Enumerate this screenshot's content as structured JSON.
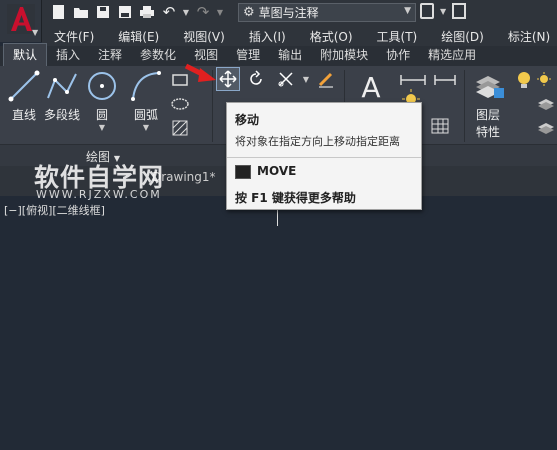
{
  "qat": {
    "workspace": "草图与注释"
  },
  "menu": [
    "文件(F)",
    "编辑(E)",
    "视图(V)",
    "插入(I)",
    "格式(O)",
    "工具(T)",
    "绘图(D)",
    "标注(N)"
  ],
  "ribbon_tabs": [
    "默认",
    "插入",
    "注释",
    "参数化",
    "视图",
    "管理",
    "输出",
    "附加模块",
    "协作",
    "精选应用"
  ],
  "draw_tools": {
    "line": "直线",
    "polyline": "多段线",
    "circle": "圆",
    "arc": "圆弧"
  },
  "layer_tool": {
    "label1": "图层",
    "label2": "特性"
  },
  "panel_title": "绘图",
  "doc_tab": "Drawing1*",
  "view_label": "[−][俯视][二维线框]",
  "watermark": {
    "line1": "软件自学网",
    "line2": "WWW.RJZXW.COM"
  },
  "tooltip": {
    "title": "移动",
    "description": "将对象在指定方向上移动指定距离",
    "command": "MOVE",
    "help": "按 F1 键获得更多帮助"
  },
  "colors": {
    "accent_red": "#c8102e",
    "canvas": "#222a36",
    "ribbon": "#3b4049"
  }
}
